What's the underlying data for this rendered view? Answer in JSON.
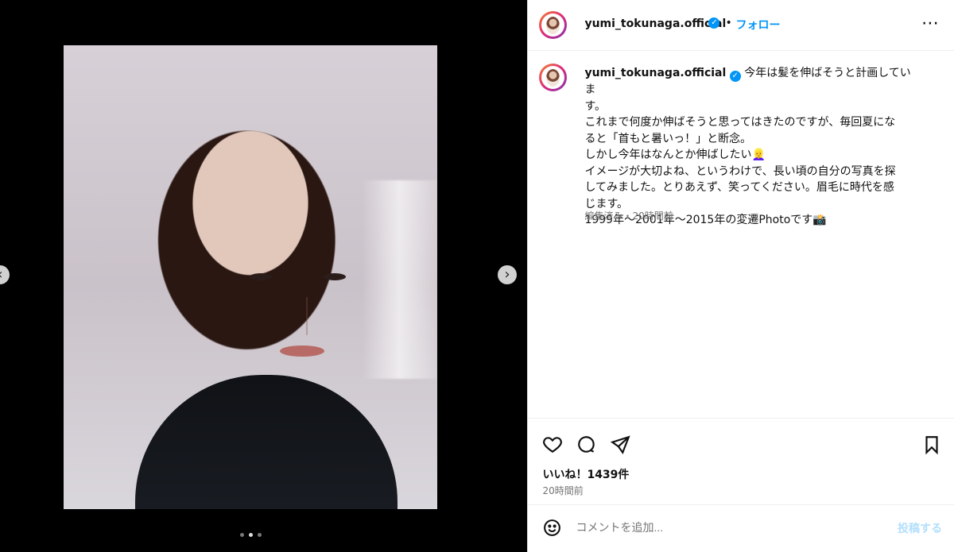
{
  "post": {
    "username": "yumi_tokunaga.official",
    "follow_label": "フォロー",
    "caption_user": "yumi_tokunaga.official",
    "caption_body": "今年は髪を伸ばそうと計画していま\nす。\nこれまで何度か伸ばそうと思ってはきたのですが、毎回夏にな\nると「首もと暑いっ！」と断念。\nしかし今年はなんとか伸ばしたい👱‍♀️\nイメージが大切よね、というわけで、長い頃の自分の写真を探\nしてみました。とりあえず、笑ってください。眉毛に時代を感\nじます。\n1999年〜2001年〜2015年の変遷Photoです📸",
    "meta": "編集済み・20時間前",
    "likes": "いいね！1439件",
    "time": "20時間前",
    "comment_placeholder": "コメントを追加...",
    "post_button": "投稿する"
  },
  "carousel": {
    "position": 2,
    "count": 3
  },
  "icons": [
    "more-icon",
    "heart-icon",
    "comment-icon",
    "share-icon",
    "bookmark-icon",
    "emoji-icon",
    "verified-icon",
    "chevron-right-icon",
    "chevron-left-icon"
  ]
}
